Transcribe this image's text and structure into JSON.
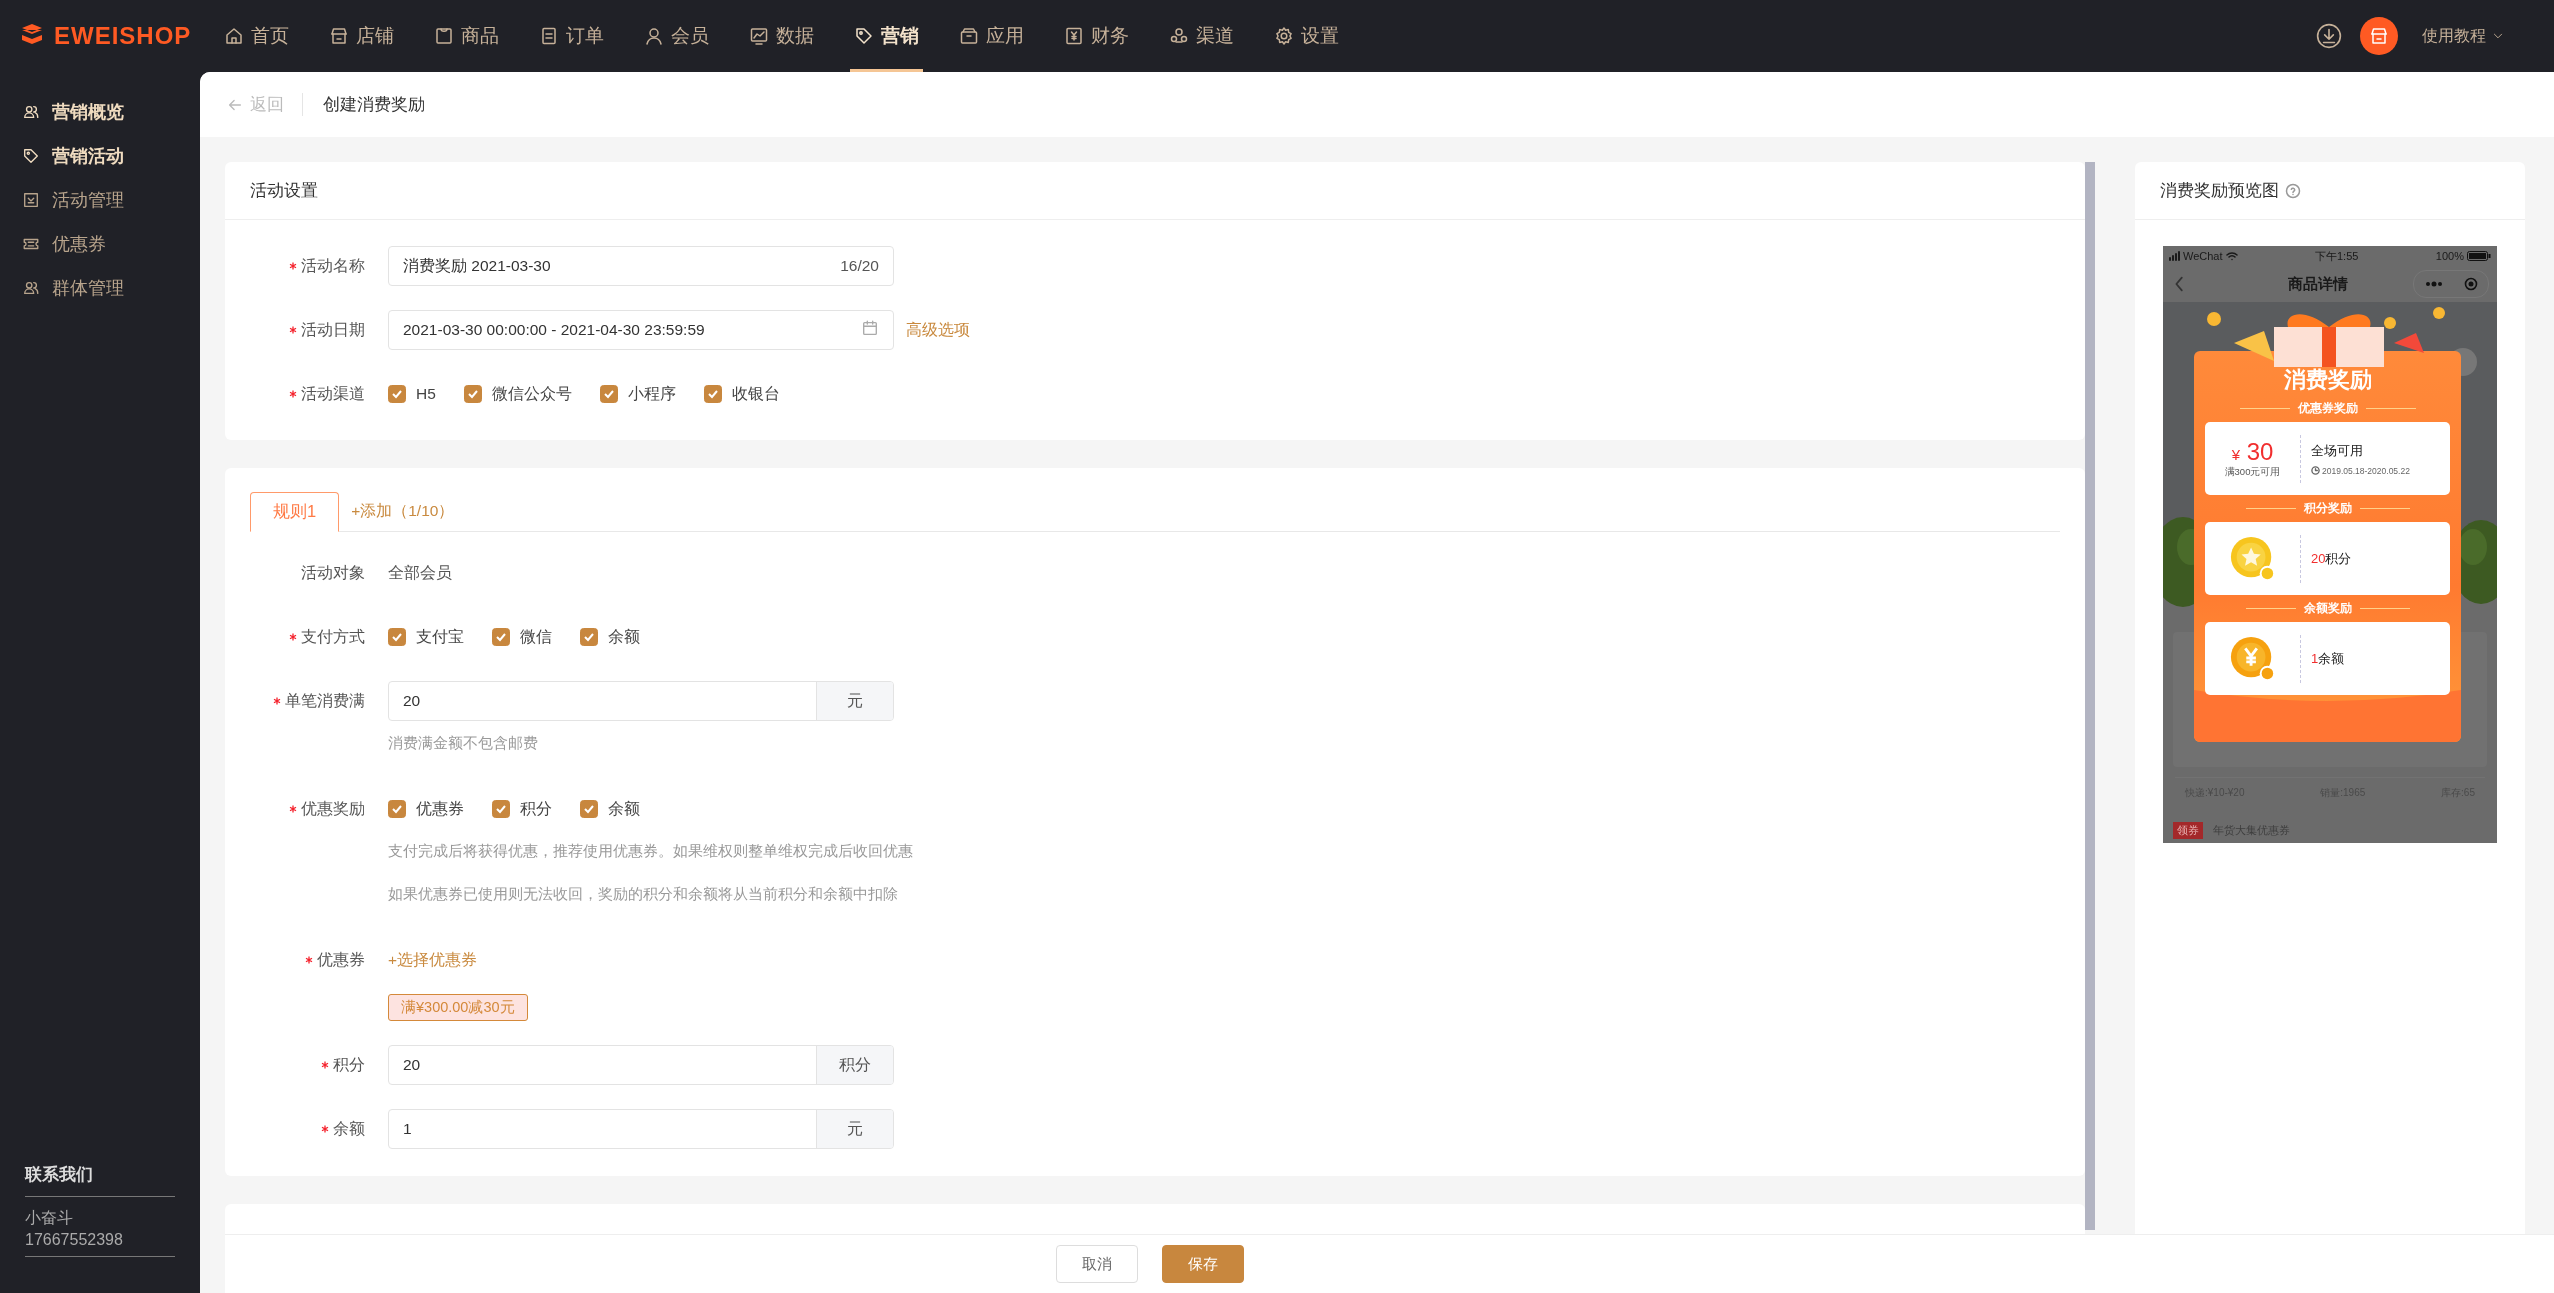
{
  "brand": {
    "name": "EWEISHOP"
  },
  "nav": [
    {
      "label": "首页",
      "selected": false
    },
    {
      "label": "店铺",
      "selected": false
    },
    {
      "label": "商品",
      "selected": false
    },
    {
      "label": "订单",
      "selected": false
    },
    {
      "label": "会员",
      "selected": false
    },
    {
      "label": "数据",
      "selected": false
    },
    {
      "label": "营销",
      "selected": true
    },
    {
      "label": "应用",
      "selected": false
    },
    {
      "label": "财务",
      "selected": false
    },
    {
      "label": "渠道",
      "selected": false
    },
    {
      "label": "设置",
      "selected": false
    }
  ],
  "topbar": {
    "help_menu": "使用教程"
  },
  "sidebar": {
    "items": [
      {
        "label": "营销概览",
        "highlighted": true
      },
      {
        "label": "营销活动",
        "highlighted": true
      },
      {
        "label": "活动管理",
        "highlighted": false
      },
      {
        "label": "优惠券",
        "highlighted": false
      },
      {
        "label": "群体管理",
        "highlighted": false
      }
    ],
    "contact": {
      "title": "联系我们",
      "name": "小奋斗",
      "phone": "17667552398"
    }
  },
  "header": {
    "back": "返回",
    "title": "创建消费奖励"
  },
  "settings": {
    "title": "活动设置",
    "fields": [
      {
        "kind": "input",
        "label": "活动名称",
        "required": true,
        "value": "消费奖励  2021-03-30",
        "counter": "16/20"
      },
      {
        "kind": "daterange",
        "label": "活动日期",
        "required": true,
        "value": "2021-03-30 00:00:00 - 2021-04-30 23:59:59",
        "link": "高级选项"
      },
      {
        "kind": "checkboxes",
        "label": "活动渠道",
        "required": true,
        "options": [
          {
            "label": "H5",
            "checked": true
          },
          {
            "label": "微信公众号",
            "checked": true
          },
          {
            "label": "小程序",
            "checked": true
          },
          {
            "label": "收银台",
            "checked": true
          }
        ]
      }
    ]
  },
  "rules": {
    "tabs": [
      {
        "label": "规则1",
        "selected": true
      }
    ],
    "add": "+添加（1/10）",
    "fields": [
      {
        "kind": "text",
        "label": "活动对象",
        "required": false,
        "value": "全部会员"
      },
      {
        "kind": "checkboxes",
        "label": "支付方式",
        "required": true,
        "options": [
          {
            "label": "支付宝",
            "checked": true
          },
          {
            "label": "微信",
            "checked": true
          },
          {
            "label": "余额",
            "checked": true
          }
        ]
      },
      {
        "kind": "input_suffix",
        "label": "单笔消费满",
        "required": true,
        "value": "20",
        "suffix": "元",
        "hints": [
          "消费满金额不包含邮费"
        ]
      },
      {
        "kind": "checkboxes",
        "label": "优惠奖励",
        "required": true,
        "options": [
          {
            "label": "优惠券",
            "checked": true
          },
          {
            "label": "积分",
            "checked": true
          },
          {
            "label": "余额",
            "checked": true
          }
        ],
        "hints": [
          "支付完成后将获得优惠，推荐使用优惠券。如果维权则整单维权完成后收回优惠",
          "如果优惠券已使用则无法收回，奖励的积分和余额将从当前积分和余额中扣除"
        ]
      },
      {
        "kind": "coupon",
        "label": "优惠券",
        "required": true,
        "link": "+选择优惠券",
        "tags": [
          "满¥300.00减30元"
        ]
      },
      {
        "kind": "input_suffix",
        "label": "积分",
        "required": true,
        "value": "20",
        "suffix": "积分"
      },
      {
        "kind": "input_suffix",
        "label": "余额",
        "required": true,
        "value": "1",
        "suffix": "元"
      }
    ]
  },
  "footer": {
    "buttons": [
      {
        "label": "取消",
        "kind": "secondary"
      },
      {
        "label": "保存",
        "kind": "primary"
      }
    ]
  },
  "preview": {
    "title": "消费奖励预览图",
    "phone": {
      "carrier": "WeChat",
      "time": "下午1:55",
      "battery": "100%",
      "page_title": "商品详情",
      "popup": {
        "title": "消费奖励",
        "sections": [
          {
            "kind": "coupon",
            "heading": "优惠券奖励",
            "currency": "¥",
            "amount": "30",
            "condition": "满300元可用",
            "scope": "全场可用",
            "validity": "2019.05.18-2020.05.22"
          },
          {
            "kind": "points",
            "heading": "积分奖励",
            "value": "20",
            "unit": "积分"
          },
          {
            "kind": "balance",
            "heading": "余额奖励",
            "value": "1",
            "unit": "余额"
          }
        ]
      },
      "product_stats": [
        "快递:¥10-¥20",
        "销量:1965",
        "库存:65"
      ],
      "coupon_banner": {
        "badge": "领券",
        "text": "年货大集优惠券"
      }
    }
  }
}
